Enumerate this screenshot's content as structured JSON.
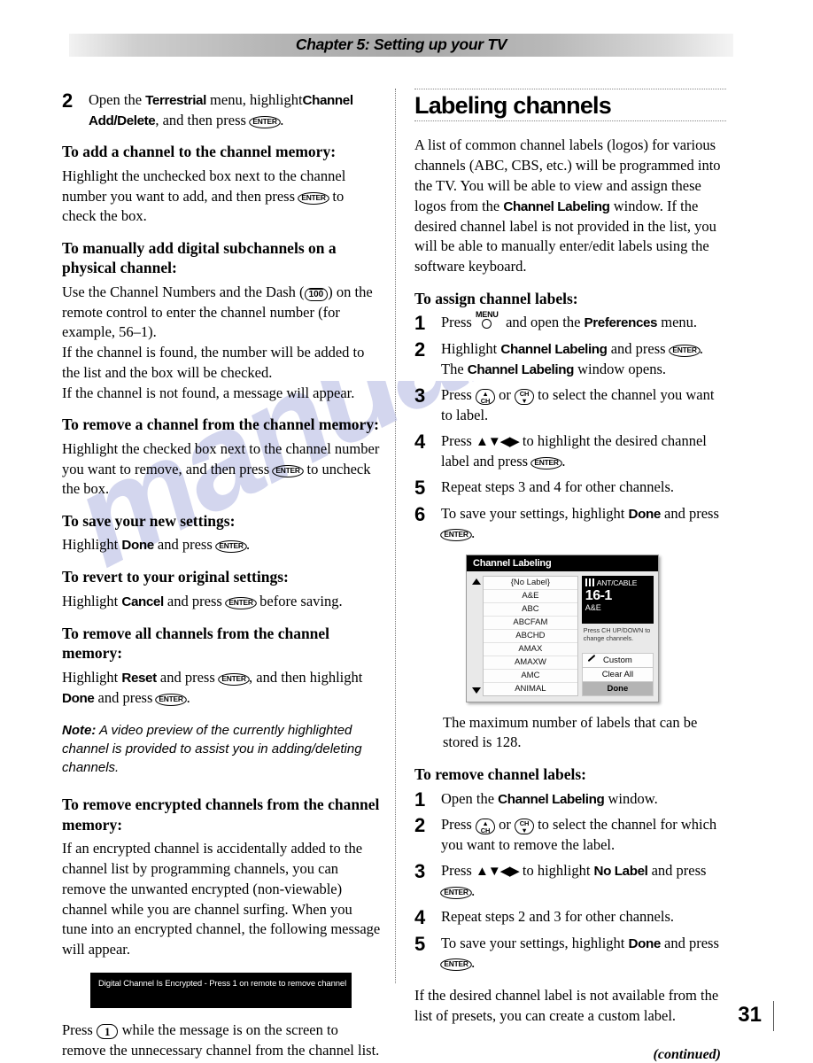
{
  "header": {
    "chapter_title": "Chapter 5: Setting up your TV"
  },
  "watermark": {
    "text": "manualshive.com"
  },
  "left_column": {
    "step2": {
      "number": "2",
      "text_a": "Open the ",
      "ui_a": "Terrestrial",
      "text_b": " menu, highlight",
      "ui_b": "Channel Add/Delete",
      "text_c": ", and then press ",
      "key": "ENTER",
      "text_d": "."
    },
    "h_add_channel": "To add a channel to the channel memory:",
    "p_add_channel_a": "Highlight the unchecked box next to the channel number you want to add, and then press ",
    "p_add_channel_key": "ENTER",
    "p_add_channel_b": " to check the box.",
    "h_manual_sub": "To manually add digital subchannels on a physical channel:",
    "p_manual_a": "Use the Channel Numbers and the Dash (",
    "p_manual_key": "100",
    "p_manual_b": ") on the remote control to enter the channel number (for example, 56–1).",
    "p_manual_found": "If the channel is found, the number will be added to the list and the box will be checked.",
    "p_manual_notfound": "If the channel is not found, a message will appear.",
    "h_remove_channel": "To remove a channel from the channel memory:",
    "p_remove_a": "Highlight the checked box next to the channel number you want to remove, and then press ",
    "p_remove_key": "ENTER",
    "p_remove_b": " to uncheck the box.",
    "h_save": "To save your new settings:",
    "p_save_a": "Highlight ",
    "p_save_ui": "Done",
    "p_save_b": " and press ",
    "p_save_key": "ENTER",
    "p_save_c": ".",
    "h_revert": "To revert to your original settings:",
    "p_revert_a": "Highlight ",
    "p_revert_ui": "Cancel",
    "p_revert_b": " and press ",
    "p_revert_key": "ENTER",
    "p_revert_c": " before saving.",
    "h_remove_all": "To remove all channels from the channel memory:",
    "p_remove_all_a": "Highlight ",
    "p_remove_all_ui1": "Reset",
    "p_remove_all_b": " and press ",
    "p_remove_all_key1": "ENTER",
    "p_remove_all_c": ", and then highlight ",
    "p_remove_all_ui2": "Done",
    "p_remove_all_d": " and press ",
    "p_remove_all_key2": "ENTER",
    "p_remove_all_e": ".",
    "note_label": "Note:",
    "note_text": " A video preview of the currently highlighted channel is provided to assist you in adding/deleting channels.",
    "h_remove_encrypted": "To remove encrypted channels from the channel memory:",
    "p_encrypted": "If an encrypted channel is accidentally added to the channel list by programming channels, you can remove the unwanted encrypted (non-viewable) channel while you are channel surfing. When you tune into an encrypted channel, the following message will appear.",
    "osd_message": "Digital Channel Is Encrypted - Press 1 on remote to remove channel",
    "p_press_one_a": "Press ",
    "p_press_one_key": "1",
    "p_press_one_b": " while the message is on the screen to remove the unnecessary channel from the channel list."
  },
  "right_column": {
    "section_heading": "Labeling channels",
    "intro_a": "A list of common channel labels (logos) for various channels (ABC, CBS, etc.) will be programmed into the TV. You will be able to view and assign these logos from the ",
    "intro_ui": "Channel Labeling",
    "intro_b": " window. If the desired channel label is not provided in the list, you will be able to manually enter/edit labels using the software keyboard.",
    "h_assign": "To assign channel labels:",
    "assign_steps": {
      "s1_num": "1",
      "s1_a": "Press ",
      "s1_key": "MENU",
      "s1_b": " and open the ",
      "s1_ui": "Preferences",
      "s1_c": " menu.",
      "s2_num": "2",
      "s2_a": "Highlight ",
      "s2_ui1": "Channel Labeling",
      "s2_b": " and press ",
      "s2_key": "ENTER",
      "s2_c": ". The ",
      "s2_ui2": "Channel Labeling",
      "s2_d": " window opens.",
      "s3_num": "3",
      "s3_a": "Press ",
      "s3_key_up": "CH",
      "s3_b": " or ",
      "s3_key_down": "CH",
      "s3_c": " to select the channel you want to label.",
      "s4_num": "4",
      "s4_a": "Press ",
      "s4_arrows": "▲▼◀▶",
      "s4_b": " to highlight the desired channel label and press ",
      "s4_key": "ENTER",
      "s4_c": ".",
      "s5_num": "5",
      "s5_text": "Repeat steps 3 and 4 for other channels.",
      "s6_num": "6",
      "s6_a": "To save your settings, highlight ",
      "s6_ui": "Done",
      "s6_b": " and press ",
      "s6_key": "ENTER",
      "s6_c": "."
    },
    "figure": {
      "title": "Channel Labeling",
      "scroll_up_icon": "triangle-up-icon",
      "scroll_down_icon": "triangle-down-icon",
      "list_items": [
        "{No Label}",
        "A&E",
        "ABC",
        "ABCFAM",
        "ABCHD",
        "AMAX",
        "AMAXW",
        "AMC",
        "ANIMAL"
      ],
      "preview": {
        "source_icon": "antenna-icon",
        "source": "ANT/CABLE",
        "channel_number": "16-1",
        "channel_label": "A&E"
      },
      "hint": "Press CH UP/DOWN to change channels.",
      "buttons": [
        {
          "label": "Custom",
          "icon": "pencil-icon",
          "selected": false
        },
        {
          "label": "Clear All",
          "icon": "",
          "selected": false
        },
        {
          "label": "Done",
          "icon": "",
          "selected": true
        }
      ]
    },
    "max_labels": "The maximum number of labels that can be stored is 128.",
    "h_remove_labels": "To remove channel labels:",
    "remove_steps": {
      "s1_num": "1",
      "s1_a": "Open the ",
      "s1_ui": "Channel Labeling",
      "s1_b": " window.",
      "s2_num": "2",
      "s2_a": "Press ",
      "s2_key_up": "CH",
      "s2_b": " or ",
      "s2_key_down": "CH",
      "s2_c": " to select the channel for which you want to remove the label.",
      "s3_num": "3",
      "s3_a": "Press ",
      "s3_arrows": "▲▼◀▶",
      "s3_b": " to highlight ",
      "s3_ui": "No Label",
      "s3_c": " and press ",
      "s3_key": "ENTER",
      "s3_d": ".",
      "s4_num": "4",
      "s4_text": "Repeat steps 2 and 3 for other channels.",
      "s5_num": "5",
      "s5_a": "To save your settings, highlight ",
      "s5_ui": "Done",
      "s5_b": " and press ",
      "s5_key": "ENTER",
      "s5_c": "."
    },
    "closing": "If the desired channel label is not available from the list of presets, you can create a custom label.",
    "continued": "(continued)"
  },
  "footer": {
    "page_number": "31"
  }
}
